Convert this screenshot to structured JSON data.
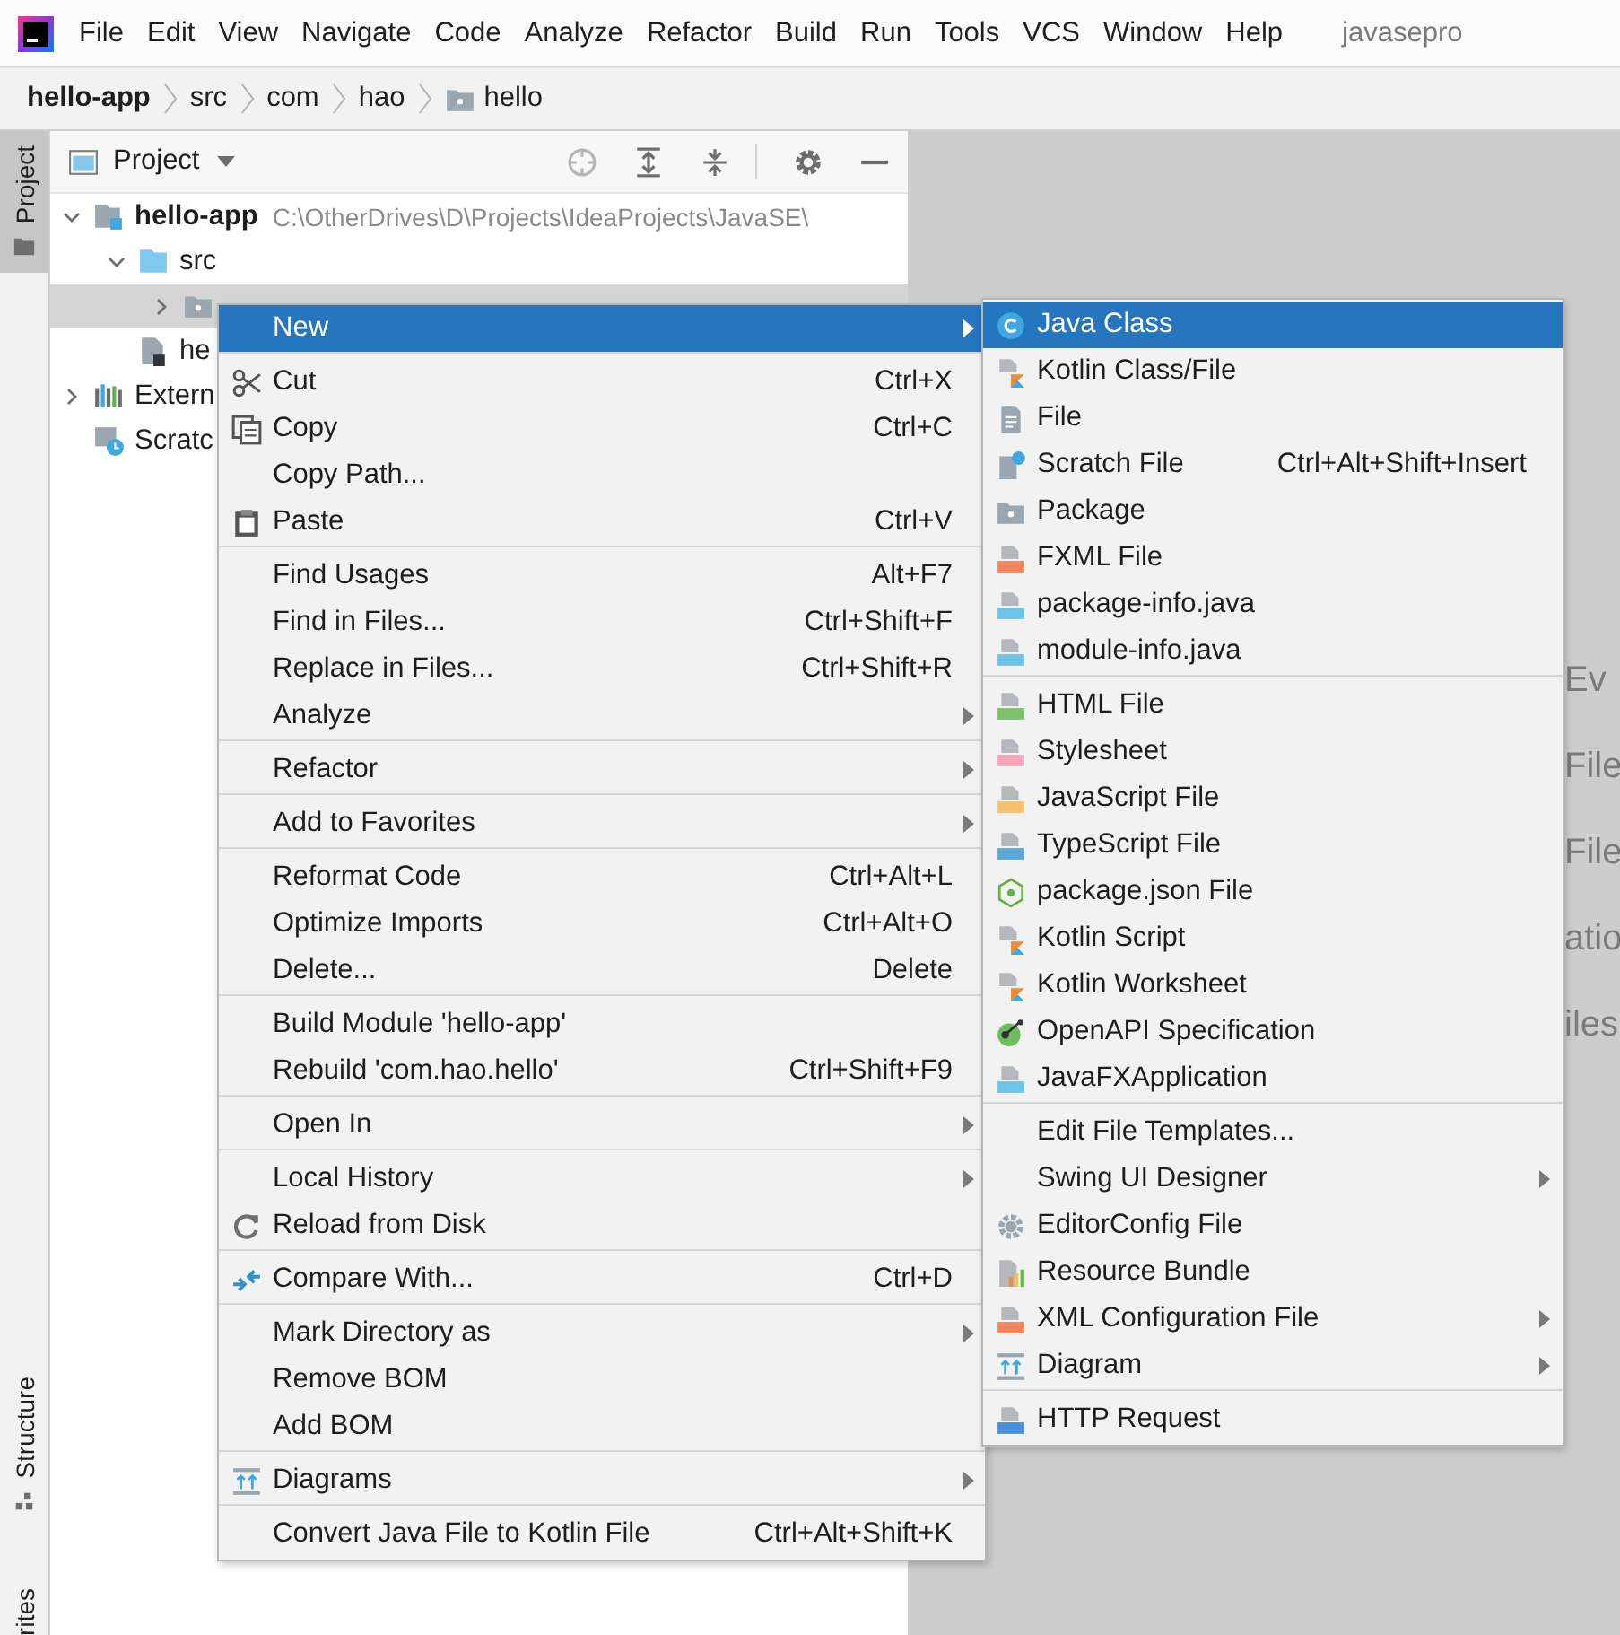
{
  "menubar": {
    "items": [
      "File",
      "Edit",
      "View",
      "Navigate",
      "Code",
      "Analyze",
      "Refactor",
      "Build",
      "Run",
      "Tools",
      "VCS",
      "Window",
      "Help"
    ],
    "title": "javasepro"
  },
  "breadcrumb": [
    {
      "label": "hello-app",
      "kind": "module"
    },
    {
      "label": "src",
      "kind": "plain"
    },
    {
      "label": "com",
      "kind": "plain"
    },
    {
      "label": "hao",
      "kind": "plain"
    },
    {
      "label": "hello",
      "kind": "package"
    }
  ],
  "tool_strip": {
    "top": [
      {
        "label": "Project",
        "selected": true
      }
    ],
    "bottom": [
      {
        "label": "Structure",
        "selected": false
      },
      {
        "label": "rites",
        "selected": false
      }
    ]
  },
  "project": {
    "title": "Project",
    "tree": [
      {
        "label": "hello-app",
        "detail": "C:\\OtherDrives\\D\\Projects\\IdeaProjects\\JavaSE\\",
        "kind": "module",
        "expanded": true,
        "selected": false,
        "children": [
          {
            "label": "src",
            "kind": "source-folder",
            "expanded": true,
            "selected": false,
            "children": [
              {
                "kind": "package",
                "expanded": false,
                "selected": true
              }
            ]
          },
          {
            "label": "he",
            "kind": "file",
            "selected": false
          }
        ]
      },
      {
        "label": "Extern",
        "kind": "libraries",
        "expanded": false,
        "selected": false
      },
      {
        "label": "Scratc",
        "kind": "scratches",
        "selected": false
      }
    ]
  },
  "editor_hints": [
    "Ev",
    "File",
    "File",
    "atio",
    "iles"
  ],
  "context_menu": {
    "groups": [
      {
        "items": [
          {
            "label": "New",
            "submenu": true,
            "selected": true
          }
        ]
      },
      {
        "items": [
          {
            "label": "Cut",
            "shortcut": "Ctrl+X",
            "submenu": false,
            "selected": false
          },
          {
            "label": "Copy",
            "shortcut": "Ctrl+C",
            "submenu": false,
            "selected": false
          },
          {
            "label": "Copy Path...",
            "submenu": false,
            "selected": false
          },
          {
            "label": "Paste",
            "shortcut": "Ctrl+V",
            "submenu": false,
            "selected": false
          }
        ]
      },
      {
        "items": [
          {
            "label": "Find Usages",
            "shortcut": "Alt+F7",
            "submenu": false,
            "selected": false
          },
          {
            "label": "Find in Files...",
            "shortcut": "Ctrl+Shift+F",
            "submenu": false,
            "selected": false
          },
          {
            "label": "Replace in Files...",
            "shortcut": "Ctrl+Shift+R",
            "submenu": false,
            "selected": false
          },
          {
            "label": "Analyze",
            "submenu": true,
            "selected": false
          }
        ]
      },
      {
        "items": [
          {
            "label": "Refactor",
            "submenu": true,
            "selected": false
          }
        ]
      },
      {
        "items": [
          {
            "label": "Add to Favorites",
            "submenu": true,
            "selected": false
          }
        ]
      },
      {
        "items": [
          {
            "label": "Reformat Code",
            "shortcut": "Ctrl+Alt+L",
            "submenu": false,
            "selected": false
          },
          {
            "label": "Optimize Imports",
            "shortcut": "Ctrl+Alt+O",
            "submenu": false,
            "selected": false
          },
          {
            "label": "Delete...",
            "shortcut": "Delete",
            "submenu": false,
            "selected": false
          }
        ]
      },
      {
        "items": [
          {
            "label": "Build Module 'hello-app'",
            "submenu": false,
            "selected": false
          },
          {
            "label": "Rebuild 'com.hao.hello'",
            "shortcut": "Ctrl+Shift+F9",
            "submenu": false,
            "selected": false
          }
        ]
      },
      {
        "items": [
          {
            "label": "Open In",
            "submenu": true,
            "selected": false
          }
        ]
      },
      {
        "items": [
          {
            "label": "Local History",
            "submenu": true,
            "selected": false
          },
          {
            "label": "Reload from Disk",
            "submenu": false,
            "selected": false
          }
        ]
      },
      {
        "items": [
          {
            "label": "Compare With...",
            "shortcut": "Ctrl+D",
            "submenu": false,
            "selected": false
          }
        ]
      },
      {
        "items": [
          {
            "label": "Mark Directory as",
            "submenu": true,
            "selected": false
          },
          {
            "label": "Remove BOM",
            "submenu": false,
            "selected": false
          },
          {
            "label": "Add BOM",
            "submenu": false,
            "selected": false
          }
        ]
      },
      {
        "items": [
          {
            "label": "Diagrams",
            "submenu": true,
            "selected": false
          }
        ]
      },
      {
        "items": [
          {
            "label": "Convert Java File to Kotlin File",
            "shortcut": "Ctrl+Alt+Shift+K",
            "submenu": false,
            "selected": false
          }
        ]
      }
    ]
  },
  "new_submenu": {
    "groups": [
      {
        "items": [
          {
            "label": "Java Class",
            "submenu": false,
            "selected": true
          },
          {
            "label": "Kotlin Class/File",
            "submenu": false,
            "selected": false
          },
          {
            "label": "File",
            "submenu": false,
            "selected": false
          },
          {
            "label": "Scratch File",
            "shortcut": "Ctrl+Alt+Shift+Insert",
            "submenu": false,
            "selected": false
          },
          {
            "label": "Package",
            "submenu": false,
            "selected": false
          },
          {
            "label": "FXML File",
            "submenu": false,
            "selected": false
          },
          {
            "label": "package-info.java",
            "submenu": false,
            "selected": false
          },
          {
            "label": "module-info.java",
            "submenu": false,
            "selected": false
          }
        ]
      },
      {
        "items": [
          {
            "label": "HTML File",
            "submenu": false,
            "selected": false
          },
          {
            "label": "Stylesheet",
            "submenu": false,
            "selected": false
          },
          {
            "label": "JavaScript File",
            "submenu": false,
            "selected": false
          },
          {
            "label": "TypeScript File",
            "submenu": false,
            "selected": false
          },
          {
            "label": "package.json File",
            "submenu": false,
            "selected": false
          },
          {
            "label": "Kotlin Script",
            "submenu": false,
            "selected": false
          },
          {
            "label": "Kotlin Worksheet",
            "submenu": false,
            "selected": false
          },
          {
            "label": "OpenAPI Specification",
            "submenu": false,
            "selected": false
          },
          {
            "label": "JavaFXApplication",
            "submenu": false,
            "selected": false
          }
        ]
      },
      {
        "items": [
          {
            "label": "Edit File Templates...",
            "submenu": false,
            "selected": false
          },
          {
            "label": "Swing UI Designer",
            "submenu": true,
            "selected": false
          },
          {
            "label": "EditorConfig File",
            "submenu": false,
            "selected": false
          },
          {
            "label": "Resource Bundle",
            "submenu": false,
            "selected": false
          },
          {
            "label": "XML Configuration File",
            "submenu": true,
            "selected": false
          },
          {
            "label": "Diagram",
            "submenu": true,
            "selected": false
          }
        ]
      },
      {
        "items": [
          {
            "label": "HTTP Request",
            "submenu": false,
            "selected": false
          }
        ]
      }
    ]
  }
}
